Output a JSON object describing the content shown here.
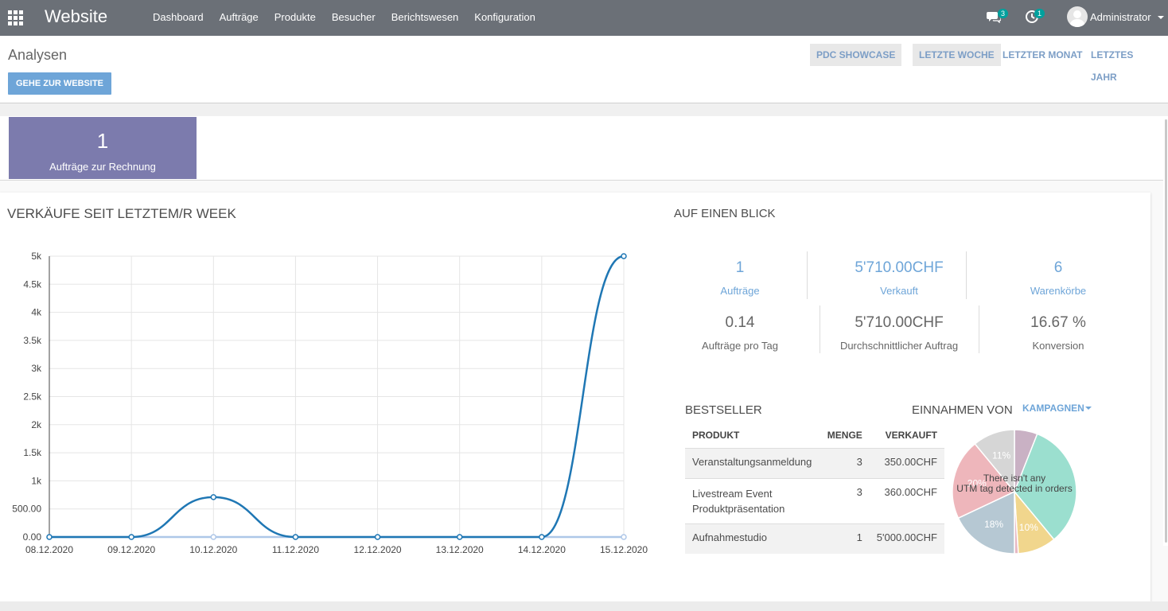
{
  "app": {
    "brand": "Website",
    "menu": [
      "Dashboard",
      "Aufträge",
      "Produkte",
      "Besucher",
      "Berichtswesen",
      "Konfiguration"
    ],
    "messages_count": "3",
    "activities_count": "1",
    "user": "Administrator"
  },
  "control": {
    "title": "Analysen",
    "go_website": "GEHE ZUR WEBSITE",
    "pdc_showcase": "PDC SHOWCASE",
    "last_week": "LETZTE WOCHE",
    "last_month": "LETZTER MONAT",
    "last_year": "LETZTES JAHR"
  },
  "kpi": {
    "value": "1",
    "label": "Aufträge zur Rechnung"
  },
  "sales_chart": {
    "title": "VERKÄUFE SEIT LETZTEM/R WEEK"
  },
  "chart_data": {
    "type": "line",
    "title": "VERKÄUFE SEIT LETZTEM/R WEEK",
    "x": [
      "08.12.2020",
      "09.12.2020",
      "10.12.2020",
      "11.12.2020",
      "12.12.2020",
      "13.12.2020",
      "14.12.2020",
      "15.12.2020"
    ],
    "y_ticks": [
      "0.00",
      "500.00",
      "1k",
      "1.5k",
      "2k",
      "2.5k",
      "3k",
      "3.5k",
      "4k",
      "4.5k",
      "5k"
    ],
    "ylim": [
      0,
      5000
    ],
    "grid": true,
    "series": [
      {
        "values": [
          0,
          0,
          710,
          0,
          0,
          0,
          0,
          5000
        ],
        "color": "#1f77b4"
      },
      {
        "values": [
          0,
          0,
          0,
          0,
          0,
          0,
          0,
          0
        ],
        "color": "#aec7e8"
      }
    ]
  },
  "glance": {
    "title": "AUF EINEN BLICK",
    "orders": {
      "value": "1",
      "label": "Aufträge"
    },
    "sold": {
      "value": "5'710.00CHF",
      "label": "Verkauft"
    },
    "carts": {
      "value": "6",
      "label": "Warenkörbe"
    },
    "orders_per_day": {
      "value": "0.14",
      "label": "Aufträge pro Tag"
    },
    "avg_order": {
      "value": "5'710.00CHF",
      "label": "Durchschnittlicher Auftrag"
    },
    "conversion": {
      "value": "16.67 %",
      "label": "Konversion"
    }
  },
  "bestseller": {
    "title": "BESTSELLER",
    "columns": [
      "PRODUKT",
      "MENGE",
      "VERKAUFT"
    ],
    "rows": [
      {
        "product": "Veranstaltungsanmeldung",
        "qty": "3",
        "sold": "350.00CHF"
      },
      {
        "product": "Livestream Event Produktpräsentation",
        "qty": "3",
        "sold": "360.00CHF"
      },
      {
        "product": "Aufnahmestudio",
        "qty": "1",
        "sold": "5'000.00CHF"
      }
    ]
  },
  "revenue": {
    "title": "EINNAHMEN VON",
    "dropdown": "KAMPAGNEN",
    "empty_message_line1": "There isn't any",
    "empty_message_line2": "UTM tag detected in orders",
    "slices": [
      {
        "label": "",
        "pct": 6,
        "color": "#c9b1c4"
      },
      {
        "label": "",
        "pct": 33,
        "color": "#9bdfcf"
      },
      {
        "label": "10%",
        "pct": 10,
        "color": "#f1d68d"
      },
      {
        "label": "",
        "pct": 1,
        "color": "#e7b9c3"
      },
      {
        "label": "18%",
        "pct": 18,
        "color": "#b6c8d3"
      },
      {
        "label": "20%",
        "pct": 21,
        "color": "#eeb6bb"
      },
      {
        "label": "11%",
        "pct": 11,
        "color": "#d6d6d6"
      }
    ]
  }
}
